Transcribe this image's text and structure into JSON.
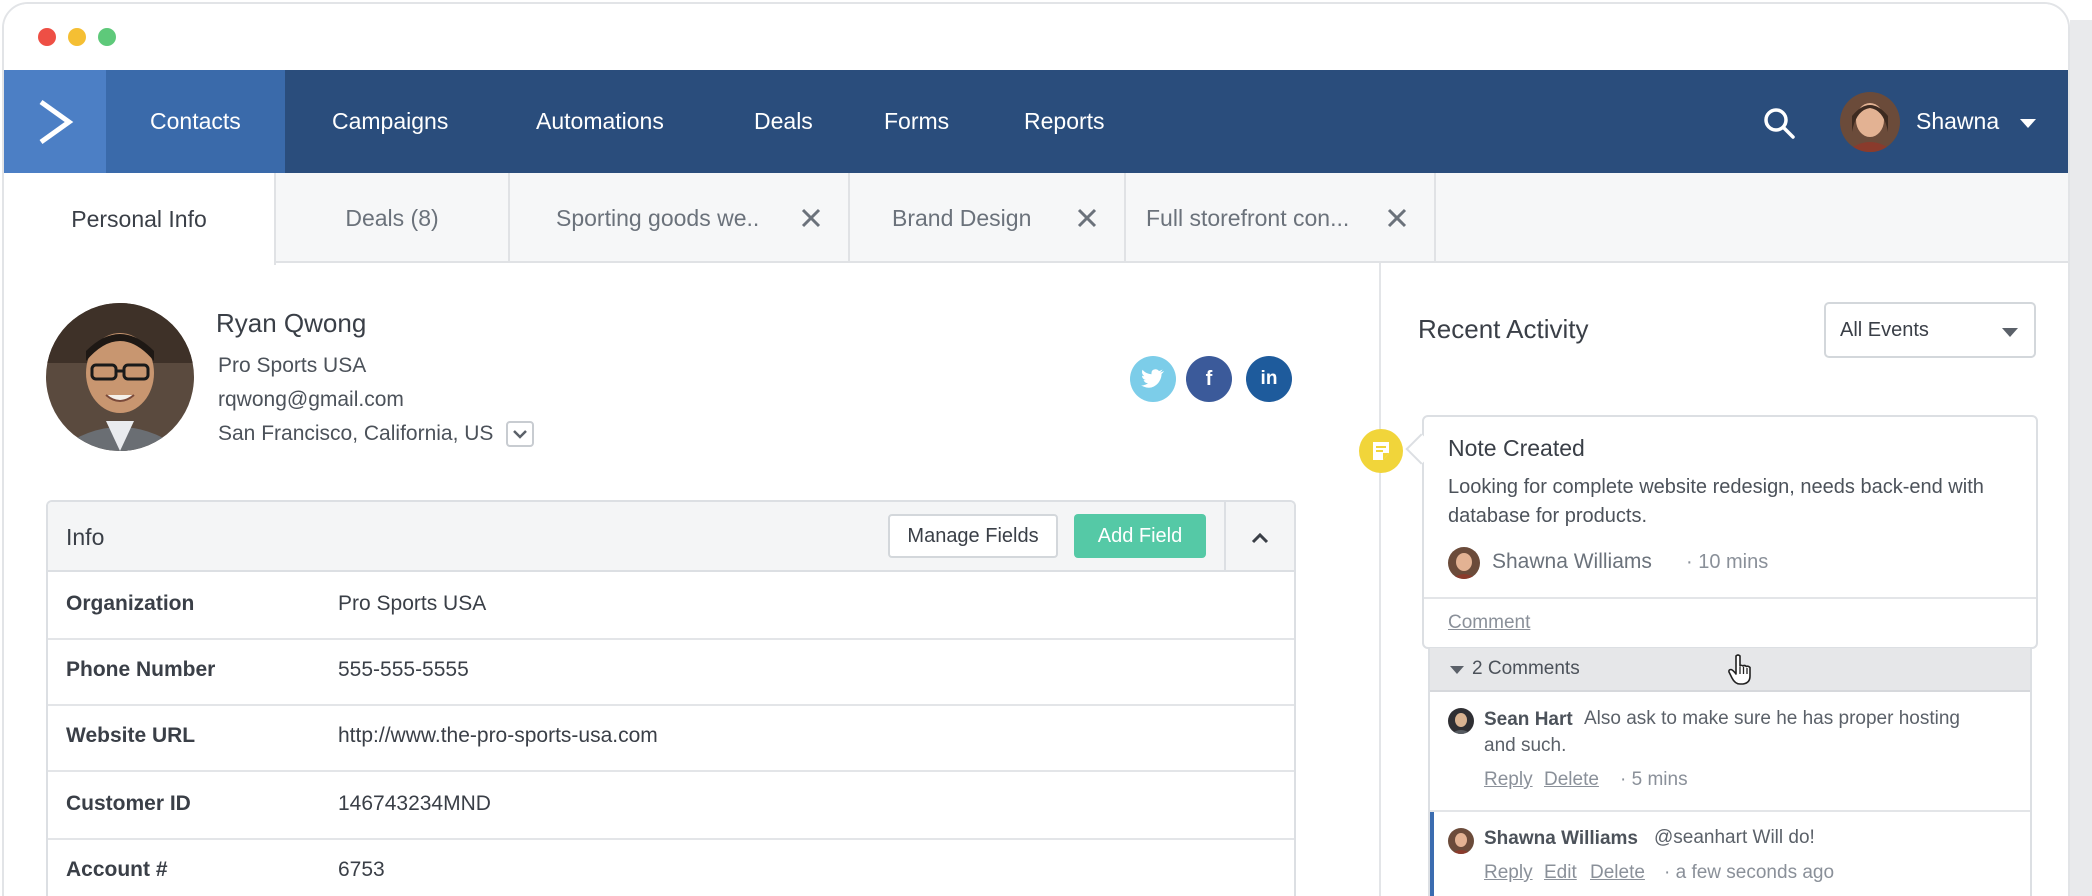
{
  "nav": {
    "items": [
      "Contacts",
      "Campaigns",
      "Automations",
      "Deals",
      "Forms",
      "Reports"
    ],
    "user_name": "Shawna"
  },
  "tabs": [
    "Personal Info",
    "Deals (8)",
    "Sporting goods we..",
    "Brand Design",
    "Full storefront con..."
  ],
  "contact": {
    "name": "Ryan Qwong",
    "company": "Pro Sports USA",
    "email": "rqwong@gmail.com",
    "location": "San Francisco, California, US"
  },
  "info": {
    "title": "Info",
    "manage_label": "Manage Fields",
    "add_label": "Add Field",
    "rows": [
      {
        "label": "Organization",
        "value": "Pro Sports USA"
      },
      {
        "label": "Phone Number",
        "value": "555-555-5555"
      },
      {
        "label": "Website URL",
        "value": "http://www.the-pro-sports-usa.com"
      },
      {
        "label": "Customer ID",
        "value": "146743234MND"
      },
      {
        "label": "Account #",
        "value": "6753"
      }
    ]
  },
  "activity": {
    "title": "Recent Activity",
    "filter": "All Events",
    "note": {
      "title": "Note Created",
      "body": "Looking for complete website redesign, needs back-end with database for products.",
      "author": "Shawna Williams",
      "time": "· 10 mins",
      "comment_link": "Comment"
    },
    "comments_label": "2 Comments",
    "comments": [
      {
        "author": "Sean Hart",
        "text_first": "Also ask to make sure he has proper hosting",
        "text_second": "and such.",
        "reply": "Reply",
        "delete": "Delete",
        "time": "· 5 mins"
      },
      {
        "author": "Shawna Williams",
        "text_first": "@seanhart Will do!",
        "reply": "Reply",
        "edit": "Edit",
        "delete": "Delete",
        "time": "· a few seconds ago"
      }
    ]
  },
  "colors": {
    "nav_bg": "#2a4d7c",
    "nav_active": "#3a6aaa",
    "logo_bg": "#4c7fc5",
    "add_button": "#55c9a6",
    "twitter": "#7ccde9",
    "facebook": "#3b5a9a",
    "linkedin": "#1e5b9c",
    "note_icon": "#f1d53a"
  },
  "icons": [
    "logo-arrow-icon",
    "search-icon",
    "chevron-down-icon",
    "close-icon",
    "twitter-icon",
    "facebook-icon",
    "linkedin-icon",
    "chevron-up-icon",
    "note-icon",
    "hand-cursor-icon"
  ]
}
